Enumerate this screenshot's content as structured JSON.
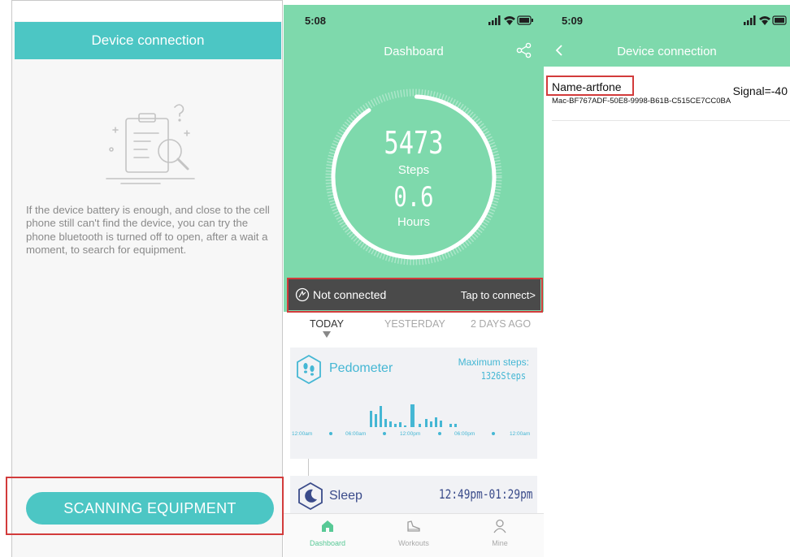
{
  "panel1": {
    "header_title": "Device connection",
    "message": "If the device battery is enough, and close to the cell phone still can't find the device, you can try the phone bluetooth is turned off to open, after a wait a moment, to search for equipment.",
    "scan_button": "SCANNING EQUIPMENT"
  },
  "panel2": {
    "status_time": "5:08",
    "title": "Dashboard",
    "steps_value": "5473",
    "steps_label": "Steps",
    "hours_value": "0.6",
    "hours_label": "Hours",
    "connection_status": "Not connected",
    "connect_link": "Tap to connect>",
    "day_tabs": [
      "TODAY",
      "YESTERDAY",
      "2 DAYS AGO"
    ],
    "active_day_tab": 0,
    "pedometer": {
      "title": "Pedometer",
      "max_label": "Maximum steps:",
      "max_value": "1326Steps",
      "axis_labels": [
        "12:00am",
        "06:00am",
        "12:00pm",
        "06:00pm",
        "12:00am"
      ]
    },
    "sleep": {
      "title": "Sleep",
      "time_range": "12:49pm-01:29pm"
    },
    "tabbar": [
      {
        "label": "Dashboard",
        "icon": "home-icon"
      },
      {
        "label": "Workouts",
        "icon": "shoe-icon"
      },
      {
        "label": "Mine",
        "icon": "person-icon"
      }
    ],
    "active_tab": 0
  },
  "panel3": {
    "status_time": "5:09",
    "title": "Device connection",
    "device": {
      "name": "Name-artfone",
      "signal": "Signal=-40",
      "mac": "Mac-BF767ADF-50E8-9998-B61B-C515CE7CC0BA"
    }
  },
  "colors": {
    "teal": "#4cc6c4",
    "green": "#7ed9ac",
    "highlight_red": "#d23b3b",
    "pedometer_blue": "#45b7d4",
    "sleep_navy": "#3a4b8a",
    "connection_bar": "#4a4a4a"
  }
}
